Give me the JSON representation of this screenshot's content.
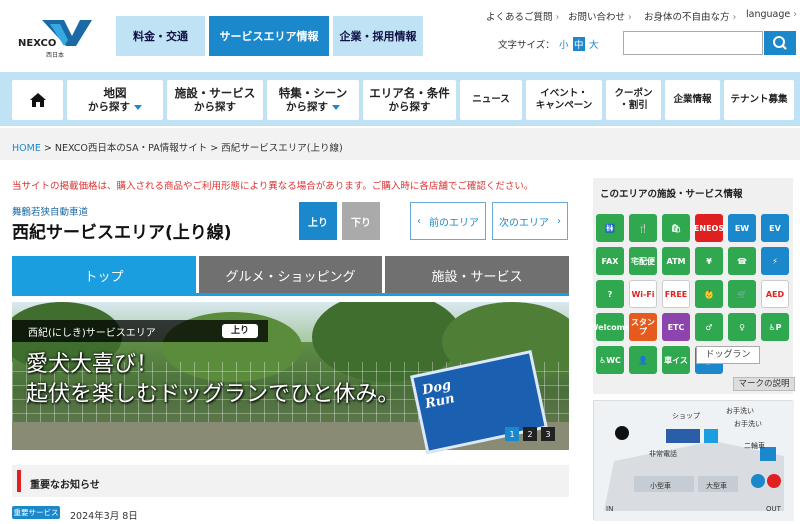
{
  "header": {
    "logo_text": "NEXCO",
    "logo_sub": "西日本",
    "nav": [
      {
        "label": "料金・交通"
      },
      {
        "label": "サービスエリア情報"
      },
      {
        "label": "企業・採用情報"
      }
    ],
    "utility": [
      {
        "label": "よくあるご質問"
      },
      {
        "label": "お問い合わせ"
      },
      {
        "label": "お身体の不自由な方"
      },
      {
        "label": "language"
      }
    ],
    "font_size_label": "文字サイズ：",
    "font_sizes": [
      "小",
      "中",
      "大"
    ],
    "search_placeholder": ""
  },
  "mainnav": [
    {
      "line1": "地図",
      "line2": "から探す"
    },
    {
      "line1": "施設・サービス",
      "line2": "から探す"
    },
    {
      "line1": "特集・シーン",
      "line2": "から探す"
    },
    {
      "line1": "エリア名・条件",
      "line2": "から探す"
    },
    {
      "line1": "ニュース",
      "line2": ""
    },
    {
      "line1": "イベント・",
      "line2": "キャンペーン"
    },
    {
      "line1": "クーポン",
      "line2": "・割引"
    },
    {
      "line1": "企業情報",
      "line2": ""
    },
    {
      "line1": "テナント募集",
      "line2": ""
    }
  ],
  "breadcrumb": {
    "home": "HOME",
    "items": [
      "NEXCO西日本のSA・PA情報サイト",
      "西紀サービスエリア(上り線)"
    ],
    "sep": ">"
  },
  "notice": "当サイトの掲載価格は、購入される商品やご利用形態により異なる場合があります。ご購入時に各店舗でご確認ください。",
  "area": {
    "road": "舞鶴若狭自動車道",
    "name": "西紀サービスエリア(上り線)",
    "up_label": "上り",
    "down_label": "下り",
    "prev_label": "前のエリア",
    "next_label": "次のエリア"
  },
  "tabs": [
    {
      "label": "トップ",
      "active": true
    },
    {
      "label": "グルメ・ショッピング",
      "active": false
    },
    {
      "label": "施設・サービス",
      "active": false
    }
  ],
  "hero": {
    "area_label": "西紀(にしき)サービスエリア",
    "direction_tag": "上り",
    "line1": "愛犬大喜び！",
    "line2": "起伏を楽しむドッグランでひと休み。",
    "sign_text_1": "Dog",
    "sign_text_2": "Run",
    "pages": [
      "1",
      "2",
      "3"
    ],
    "active_page": 1
  },
  "news": {
    "title": "重要なお知らせ",
    "badge": "重要サービス",
    "date": "2024年3月 8日"
  },
  "facilities": {
    "title": "このエリアの施設・サービス情報",
    "tooltip": "ドッグラン",
    "legend_button": "マークの説明",
    "icons": [
      {
        "name": "restroom-icon",
        "color": "#2fa84f",
        "text": "🚻"
      },
      {
        "name": "restaurant-icon",
        "color": "#2fa84f",
        "text": "🍴"
      },
      {
        "name": "shopping-icon",
        "color": "#2fa84f",
        "text": "🛍"
      },
      {
        "name": "eneos-icon",
        "color": "#e02020",
        "text": "ENEOS"
      },
      {
        "name": "ew-charge-icon",
        "color": "#1b88cc",
        "text": "EW"
      },
      {
        "name": "ev-quick-icon",
        "color": "#1b88cc",
        "text": "EV"
      },
      {
        "name": "fax-icon",
        "color": "#2fa84f",
        "text": "FAX"
      },
      {
        "name": "delivery-icon",
        "color": "#2fa84f",
        "text": "宅配便"
      },
      {
        "name": "atm-icon",
        "color": "#2fa84f",
        "text": "ATM"
      },
      {
        "name": "vending-icon",
        "color": "#2fa84f",
        "text": "¥"
      },
      {
        "name": "highway-info-icon",
        "color": "#2fa84f",
        "text": "☎"
      },
      {
        "name": "ev-plug-icon",
        "color": "#1b88cc",
        "text": "⚡"
      },
      {
        "name": "info-icon",
        "color": "#2fa84f",
        "text": "?"
      },
      {
        "name": "wifi-icon",
        "color": "#ffffff",
        "text": "Wi-Fi"
      },
      {
        "name": "highway-wifi-icon",
        "color": "#ffffff",
        "text": "FREE"
      },
      {
        "name": "nursing-room-icon",
        "color": "#2fa84f",
        "text": "👶"
      },
      {
        "name": "cart-icon",
        "color": "#2fa84f",
        "text": "🛒"
      },
      {
        "name": "aed-icon",
        "color": "#ffffff",
        "text": "AED"
      },
      {
        "name": "welcome-icon",
        "color": "#2fa84f",
        "text": "Welcome"
      },
      {
        "name": "stamp-icon",
        "color": "#e65a1e",
        "text": "スタンプ"
      },
      {
        "name": "etc-icon",
        "color": "#8e44ad",
        "text": "ETC"
      },
      {
        "name": "mens-restroom-icon",
        "color": "#2fa84f",
        "text": "♂"
      },
      {
        "name": "womens-restroom-icon",
        "color": "#2fa84f",
        "text": "♀"
      },
      {
        "name": "accessible-parking-icon",
        "color": "#2fa84f",
        "text": "♿P"
      },
      {
        "name": "accessible-wc-icon",
        "color": "#2fa84f",
        "text": "♿WC"
      },
      {
        "name": "baby-icon",
        "color": "#2fa84f",
        "text": "👤"
      },
      {
        "name": "wheelchair-rental-icon",
        "color": "#2fa84f",
        "text": "車イス"
      },
      {
        "name": "dogrun-icon",
        "color": "#1b88cc",
        "text": "🐕"
      }
    ]
  },
  "map": {
    "labels": [
      "ショップ",
      "お手洗い",
      "お手洗い",
      "二輪車",
      "非常電話",
      "小型車",
      "大型車",
      "IN",
      "OUT"
    ]
  }
}
